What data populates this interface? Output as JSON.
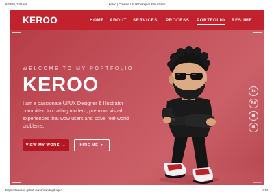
{
  "print_header": {
    "datetime": "6/20/26, 2:46 AM",
    "title": "Keroo | Creative UI/UX Designer & Illustrator"
  },
  "nav": {
    "logo": "KEROO",
    "items": [
      {
        "label": "HOME",
        "active": false
      },
      {
        "label": "ABOUT",
        "active": false
      },
      {
        "label": "SERVICES",
        "active": false
      },
      {
        "label": "PROCESS",
        "active": false
      },
      {
        "label": "PORTFOLIO",
        "active": true
      },
      {
        "label": "RESUME",
        "active": false
      }
    ]
  },
  "hero": {
    "welcome": "WELCOME TO MY PORTFOLIO",
    "name": "KEROO",
    "description": "I am a passionate UI/UX Designer & Illustrator committed to crafting modern, premium visual experiences that wow users and solve real-world problems.",
    "primary_button": "VIEW MY WORK",
    "secondary_button": "HIRE ME"
  },
  "social": [
    {
      "icon": "linkedin-icon",
      "glyph": "in"
    },
    {
      "icon": "behance-icon",
      "glyph": "Bē"
    },
    {
      "icon": "dribbble-icon",
      "glyph": "◍"
    },
    {
      "icon": "email-icon",
      "glyph": "✉"
    }
  ],
  "print_footer": {
    "url": "https://daniel-ell.github.io/keroLandingPage/",
    "page": "1/14"
  },
  "colors": {
    "nav": "#c1222d",
    "primary_button": "#b41722",
    "background": "#c2515b"
  }
}
